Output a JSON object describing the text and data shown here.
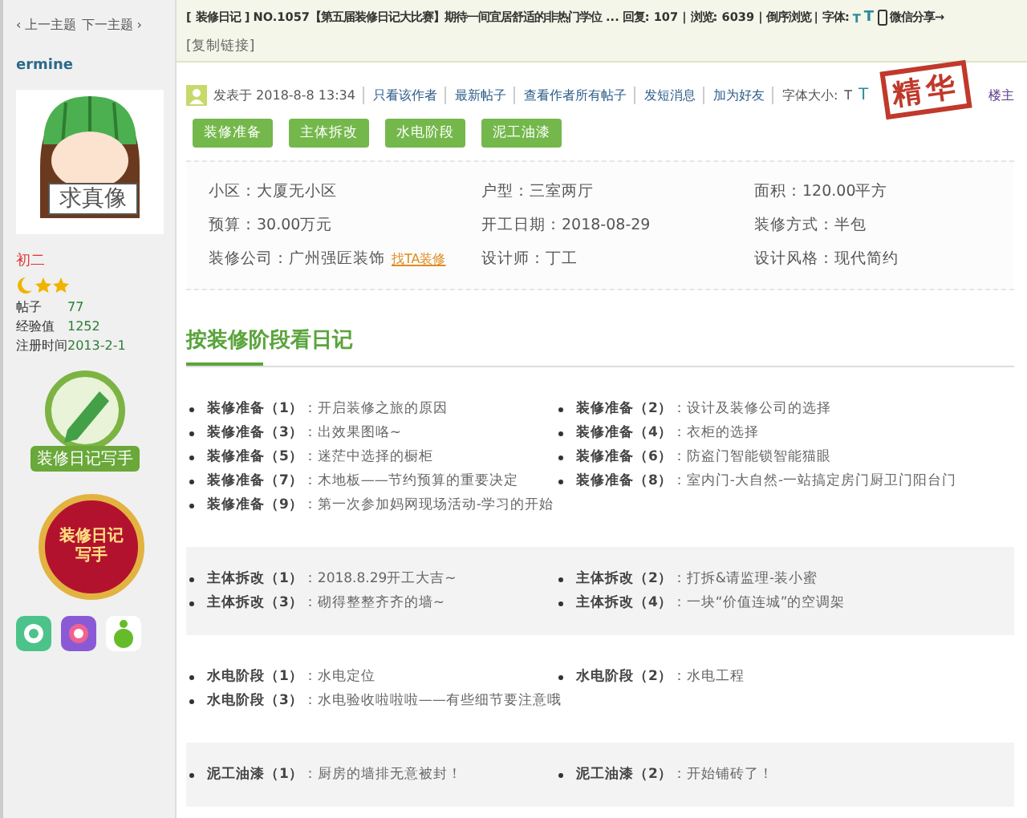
{
  "nav": {
    "prev": "‹ 上一主题",
    "next": "下一主题 ›"
  },
  "title_bar": {
    "category": "[ 装修日记 ]",
    "title": "NO.1057【第五届装修日记大比赛】期待一间宜居舒适的非热门学位 ...",
    "stats": "回复: 107 | 浏览: 6039 |",
    "reverse": "倒序浏览",
    "font_label": "| 字体:",
    "font_small": "T",
    "font_large": "T",
    "share": "微信分享→",
    "copy_link": "[复制链接]"
  },
  "author": {
    "name": "ermine",
    "avatar_sign": "求真像",
    "rank": "初二",
    "stats": [
      {
        "label": "帖子",
        "value": "77"
      },
      {
        "label": "经验值",
        "value": "1252"
      },
      {
        "label": "注册时间",
        "value": "2013-2-1"
      }
    ],
    "badges": [
      {
        "kind": "ribbon",
        "label": "装修日记写手"
      },
      {
        "kind": "seal",
        "label": "装修日记写手"
      }
    ]
  },
  "post_meta": {
    "posted": "发表于 2018-8-8 13:34",
    "links": [
      "只看该作者",
      "最新帖子",
      "查看作者所有帖子",
      "发短消息",
      "加为好友"
    ],
    "font_label": "字体大小:",
    "font_small": "T",
    "font_large": "T",
    "stamp": "精华",
    "floor": "楼主"
  },
  "tags": [
    "装修准备",
    "主体拆改",
    "水电阶段",
    "泥工油漆"
  ],
  "info": [
    {
      "label": "小区：",
      "value": "大厦无小区"
    },
    {
      "label": "户型：",
      "value": "三室两厅"
    },
    {
      "label": "面积：",
      "value": "120.00平方"
    },
    {
      "label": "预算：",
      "value": "30.00万元"
    },
    {
      "label": "开工日期：",
      "value": "2018-08-29"
    },
    {
      "label": "装修方式：",
      "value": "半包"
    },
    {
      "label": "装修公司：",
      "value": "广州强匠装饰",
      "link": "找TA装修"
    },
    {
      "label": "设计师：",
      "value": "丁工"
    },
    {
      "label": "设计风格：",
      "value": "现代简约"
    }
  ],
  "section_heading": "按装修阶段看日记",
  "stages": [
    {
      "items": [
        {
          "label": "装修准备（1）",
          "text": "：开启装修之旅的原因"
        },
        {
          "label": "装修准备（2）",
          "text": "：设计及装修公司的选择"
        },
        {
          "label": "装修准备（3）",
          "text": "：出效果图咯~"
        },
        {
          "label": "装修准备（4）",
          "text": "：衣柜的选择"
        },
        {
          "label": "装修准备（5）",
          "text": "：迷茫中选择的橱柜"
        },
        {
          "label": "装修准备（6）",
          "text": "：防盗门智能锁智能猫眼"
        },
        {
          "label": "装修准备（7）",
          "text": "：木地板——节约预算的重要决定"
        },
        {
          "label": "装修准备（8）",
          "text": "：室内门-大自然-一站搞定房门厨卫门阳台门"
        },
        {
          "label": "装修准备（9）",
          "text": "：第一次参加妈网现场活动-学习的开始"
        }
      ]
    },
    {
      "items": [
        {
          "label": "主体拆改（1）",
          "text": "：2018.8.29开工大吉~"
        },
        {
          "label": "主体拆改（2）",
          "text": "：打拆&请监理-装小蜜"
        },
        {
          "label": "主体拆改（3）",
          "text": "：砌得整整齐齐的墙~"
        },
        {
          "label": "主体拆改（4）",
          "text": "：一块“价值连城”的空调架"
        }
      ]
    },
    {
      "items": [
        {
          "label": "水电阶段（1）",
          "text": "：水电定位"
        },
        {
          "label": "水电阶段（2）",
          "text": "：水电工程"
        },
        {
          "label": "水电阶段（3）",
          "text": "：水电验收啦啦啦——有些细节要注意哦"
        }
      ]
    },
    {
      "items": [
        {
          "label": "泥工油漆（1）",
          "text": "：厨房的墙排无意被封！"
        },
        {
          "label": "泥工油漆（2）",
          "text": "：开始铺砖了！"
        }
      ]
    }
  ]
}
